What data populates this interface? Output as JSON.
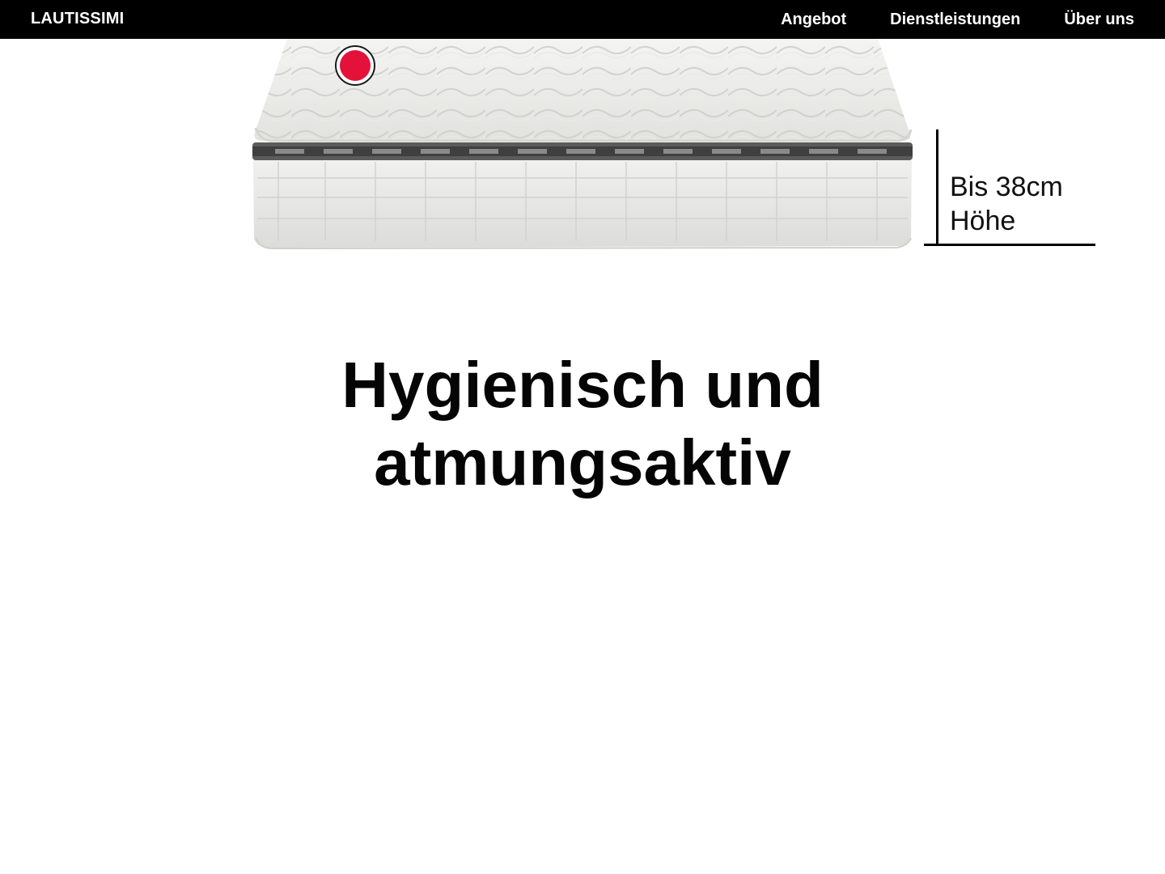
{
  "header": {
    "brand": "LAUTISSIMI",
    "nav": [
      {
        "label": "Angebot"
      },
      {
        "label": "Dienstleistungen"
      },
      {
        "label": "Über uns"
      }
    ]
  },
  "hero": {
    "image_icon": "mattress-image",
    "hotspot_color": "#e4123a",
    "height_label_line1": "Bis 38cm",
    "height_label_line2": "Höhe"
  },
  "main": {
    "headline_line1": "Hygienisch und",
    "headline_line2": "atmungsaktiv"
  }
}
